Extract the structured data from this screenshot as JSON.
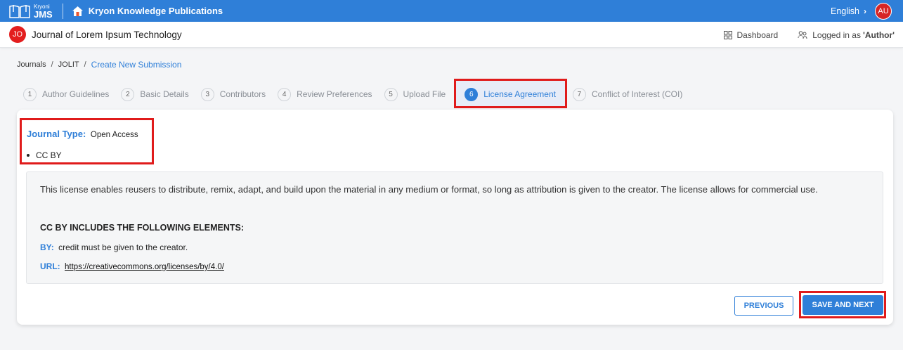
{
  "topbar": {
    "brand_small": "Kryoni",
    "brand_big": "JMS",
    "publisher": "Kryon Knowledge Publications",
    "language": "English",
    "user_initials": "AU"
  },
  "subheader": {
    "journal_initials": "JO",
    "journal_name": "Journal of Lorem Ipsum Technology",
    "dashboard_label": "Dashboard",
    "logged_prefix": "Logged in as",
    "logged_role": "'Author'"
  },
  "breadcrumb": {
    "items": [
      "Journals",
      "JOLIT",
      "Create New Submission"
    ]
  },
  "steps": [
    {
      "num": "1",
      "label": "Author Guidelines"
    },
    {
      "num": "2",
      "label": "Basic Details"
    },
    {
      "num": "3",
      "label": "Contributors"
    },
    {
      "num": "4",
      "label": "Review Preferences"
    },
    {
      "num": "5",
      "label": "Upload File"
    },
    {
      "num": "6",
      "label": "License Agreement"
    },
    {
      "num": "7",
      "label": "Conflict of Interest (COI)"
    }
  ],
  "license": {
    "journal_type_label": "Journal Type:",
    "journal_type_value": "Open Access",
    "license_name": "CC BY",
    "description": "This license enables reusers to distribute, remix, adapt, and build upon the material in any medium or format, so long as attribution is given to the creator. The license allows for commercial use.",
    "includes_heading": "CC BY INCLUDES THE FOLLOWING ELEMENTS:",
    "by_label": "BY:",
    "by_text": "credit must be given to the creator.",
    "url_label": "URL:",
    "url_text": "https://creativecommons.org/licenses/by/4.0/"
  },
  "buttons": {
    "previous": "PREVIOUS",
    "save_next": "SAVE AND NEXT"
  },
  "colors": {
    "primary": "#2f7fd8",
    "highlight": "#e01b1b",
    "avatar": "#e31e1e"
  },
  "icons": {
    "brand": "book-icon",
    "home": "home-icon",
    "dashboard": "grid-icon",
    "user": "users-icon",
    "language": "chevron-right-icon"
  }
}
